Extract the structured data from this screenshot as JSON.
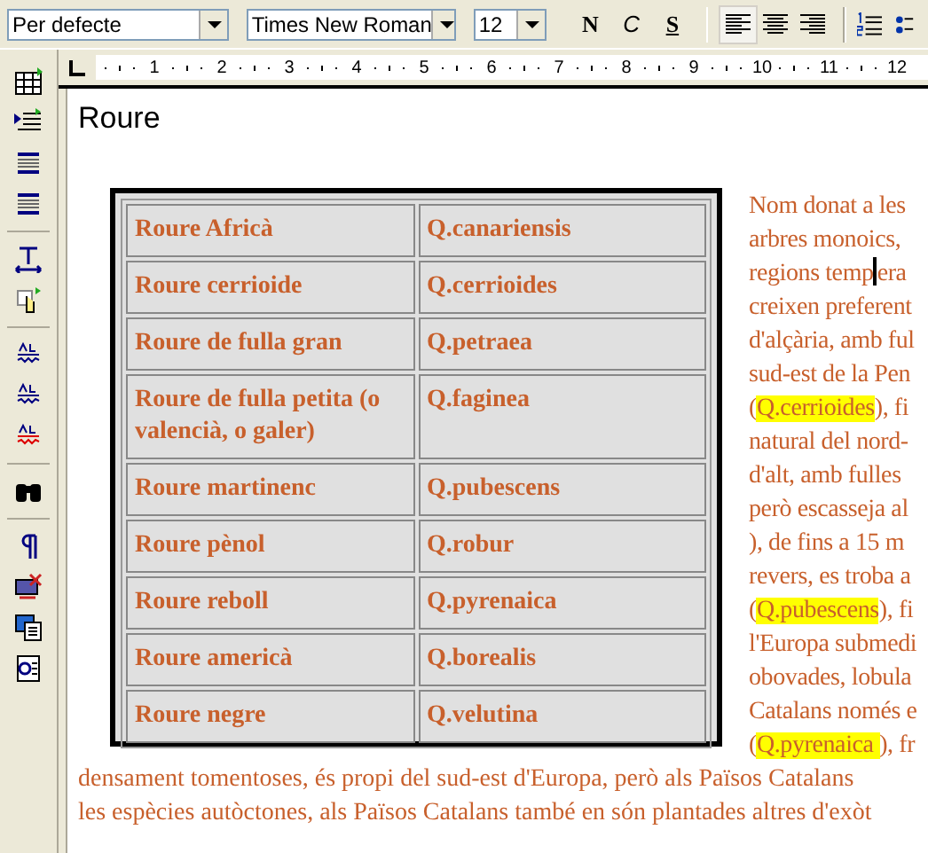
{
  "toolbar": {
    "style": "Per defecte",
    "font": "Times New Roman",
    "size": "12",
    "format_buttons": [
      {
        "label": "N",
        "kind": "bold"
      },
      {
        "label": "C",
        "kind": "italic"
      },
      {
        "label": "S",
        "kind": "underline"
      }
    ],
    "align_buttons": [
      {
        "kind": "left",
        "selected": true
      },
      {
        "kind": "center",
        "selected": false
      },
      {
        "kind": "right",
        "selected": false
      }
    ]
  },
  "ruler": {
    "numbers": [
      "1",
      "2",
      "3",
      "4",
      "5",
      "6",
      "7",
      "8",
      "9",
      "10",
      "11",
      "12"
    ]
  },
  "document": {
    "title": "Roure",
    "table": [
      {
        "name": "Roure Africà",
        "species": "Q.canariensis"
      },
      {
        "name": "Roure cerrioide",
        "species": "Q.cerrioides"
      },
      {
        "name": "Roure de fulla gran",
        "species": "Q.petraea"
      },
      {
        "name": "Roure de fulla petita (o valencià, o galer)",
        "species": "Q.faginea"
      },
      {
        "name": "Roure martinenc",
        "species": "Q.pubescens"
      },
      {
        "name": "Roure pènol",
        "species": "Q.robur"
      },
      {
        "name": "Roure reboll",
        "species": "Q.pyrenaica"
      },
      {
        "name": "Roure americà",
        "species": "Q.borealis"
      },
      {
        "name": "Roure negre",
        "species": "Q.velutina"
      }
    ],
    "side_lines": [
      [
        {
          "text": "Nom donat a les",
          "highlighted": false
        }
      ],
      [
        {
          "text": "arbres monoics,",
          "highlighted": false
        }
      ],
      [
        {
          "text": "regions temp",
          "highlighted": false,
          "caret_after": true
        },
        {
          "text": "era",
          "highlighted": false
        }
      ],
      [
        {
          "text": "creixen preferent",
          "highlighted": false
        }
      ],
      [
        {
          "text": "d'alçària, amb ful",
          "highlighted": false
        }
      ],
      [
        {
          "text": "sud-est de la Pen",
          "highlighted": false
        }
      ],
      [
        {
          "text": "(",
          "highlighted": false
        },
        {
          "text": "Q.cerrioides",
          "highlighted": true
        },
        {
          "text": "), fi",
          "highlighted": false
        }
      ],
      [
        {
          "text": "natural del nord-",
          "highlighted": false
        }
      ],
      [
        {
          "text": "d'alt, amb fulles",
          "highlighted": false
        }
      ],
      [
        {
          "text": "però escasseja al",
          "highlighted": false
        }
      ],
      [
        {
          "text": "), de fins a 15 m",
          "highlighted": false
        }
      ],
      [
        {
          "text": "revers, es troba a",
          "highlighted": false
        }
      ],
      [
        {
          "text": "(",
          "highlighted": false
        },
        {
          "text": "Q.pubescens",
          "highlighted": true
        },
        {
          "text": "), fi",
          "highlighted": false
        }
      ],
      [
        {
          "text": "l'Europa submedi",
          "highlighted": false
        }
      ],
      [
        {
          "text": "obovades, lobula",
          "highlighted": false
        }
      ],
      [
        {
          "text": "Catalans només e",
          "highlighted": false
        }
      ],
      [
        {
          "text": "(",
          "highlighted": false
        },
        {
          "text": "Q.pyrenaica ",
          "highlighted": true
        },
        {
          "text": "), fr",
          "highlighted": false
        }
      ]
    ],
    "bottom_lines": [
      "densament tomentoses, és propi del sud-est d'Europa, però als Països Catalans",
      "les espècies autòctones, als Països Catalans també en són plantades altres d'exòt"
    ]
  }
}
